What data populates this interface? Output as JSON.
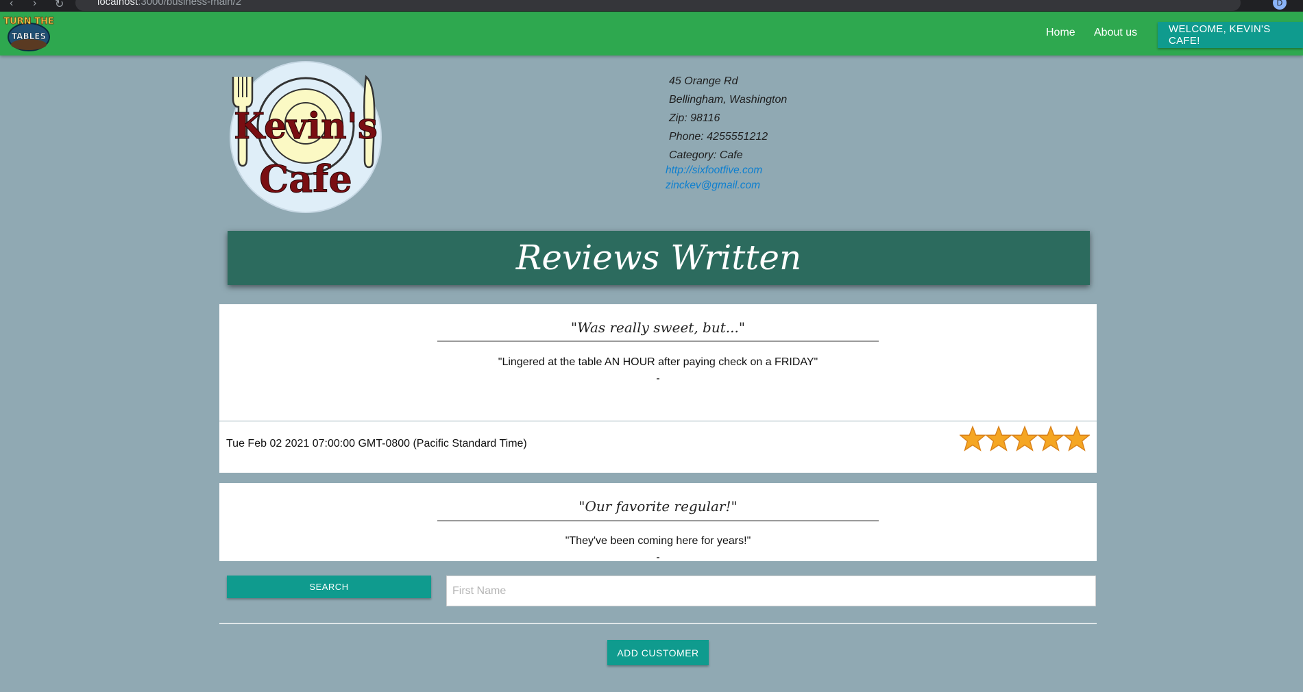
{
  "browser": {
    "url_host": "localhost",
    "url_path": ":3000/business-main/2",
    "profile_initial": "D"
  },
  "nav": {
    "logo_text_top": "TURN THE",
    "logo_text_bottom": "TABLES",
    "home": "Home",
    "about": "About us",
    "welcome": "WELCOME, KEVIN'S CAFE!"
  },
  "business": {
    "logo_text_top": "Kevin's",
    "logo_text_bottom": "Cafe",
    "address": "45 Orange Rd",
    "city_state": "Bellingham, Washington",
    "zip": "Zip: 98116",
    "phone": "Phone: 4255551212",
    "category": "Category: Cafe",
    "website": "http://sixfootfive.com",
    "email": "zinckev@gmail.com"
  },
  "reviews": {
    "heading": "Reviews Written",
    "items": [
      {
        "title": "\"Was really sweet, but...\"",
        "body": "\"Lingered at the table AN HOUR after paying check on a FRIDAY\"",
        "dash": "-",
        "date": "Tue Feb 02 2021 07:00:00 GMT-0800 (Pacific Standard Time)",
        "rating": 5
      },
      {
        "title": "\"Our favorite regular!\"",
        "body": "\"They've been coming here for years!\"",
        "dash": "-"
      }
    ]
  },
  "search": {
    "button": "SEARCH",
    "placeholder": "First Name"
  },
  "add_customer": "ADD CUSTOMER",
  "colors": {
    "nav_green": "#2ea84f",
    "teal_button": "#0f9b8e",
    "banner": "#2c6b5e",
    "background": "#90a9b3",
    "star": "#f5a623"
  }
}
